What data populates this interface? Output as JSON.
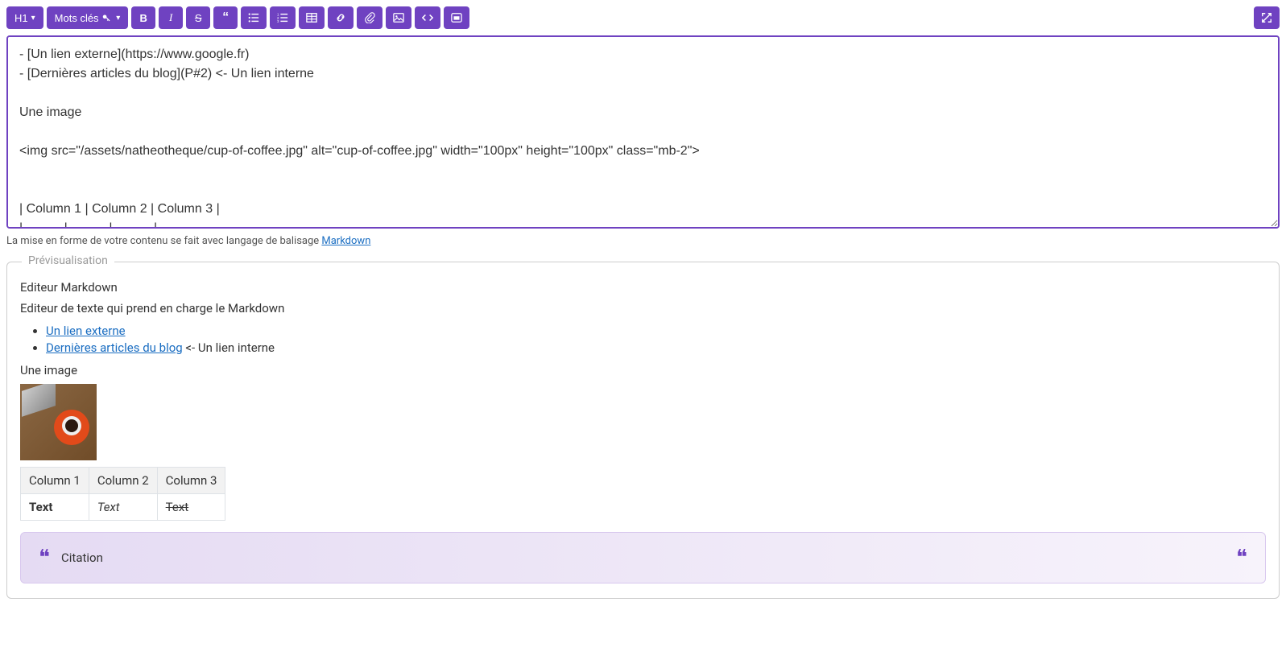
{
  "toolbar": {
    "h1_label": "H1",
    "keywords_label": "Mots clés"
  },
  "editor": {
    "content": "- [Un lien externe](https://www.google.fr)\n- [Dernières articles du blog](P#2) <- Un lien interne\n\nUne image\n\n<img src=\"/assets/natheotheque/cup-of-coffee.jpg\" alt=\"cup-of-coffee.jpg\" width=\"100px\" height=\"100px\" class=\"mb-2\">\n\n\n| Column 1 | Column 2 | Column 3 |\n| -------- | -------- | -------- |\n| **Text**     | *Text*     |     Text     |"
  },
  "help": {
    "prefix": "La mise en forme de votre contenu se fait avec langage de balisage ",
    "link_text": "Markdown"
  },
  "preview": {
    "legend": "Prévisualisation",
    "heading": "Editeur Markdown",
    "subheading": "Editeur de texte qui prend en charge le Markdown",
    "link_external": "Un lien externe",
    "link_internal": "Dernières articles du blog",
    "link_internal_suffix": " <- Un lien interne",
    "image_caption": "Une image",
    "table": {
      "headers": [
        "Column 1",
        "Column 2",
        "Column 3"
      ],
      "row": [
        "Text",
        "Text",
        "Text"
      ]
    },
    "blockquote": "Citation"
  }
}
